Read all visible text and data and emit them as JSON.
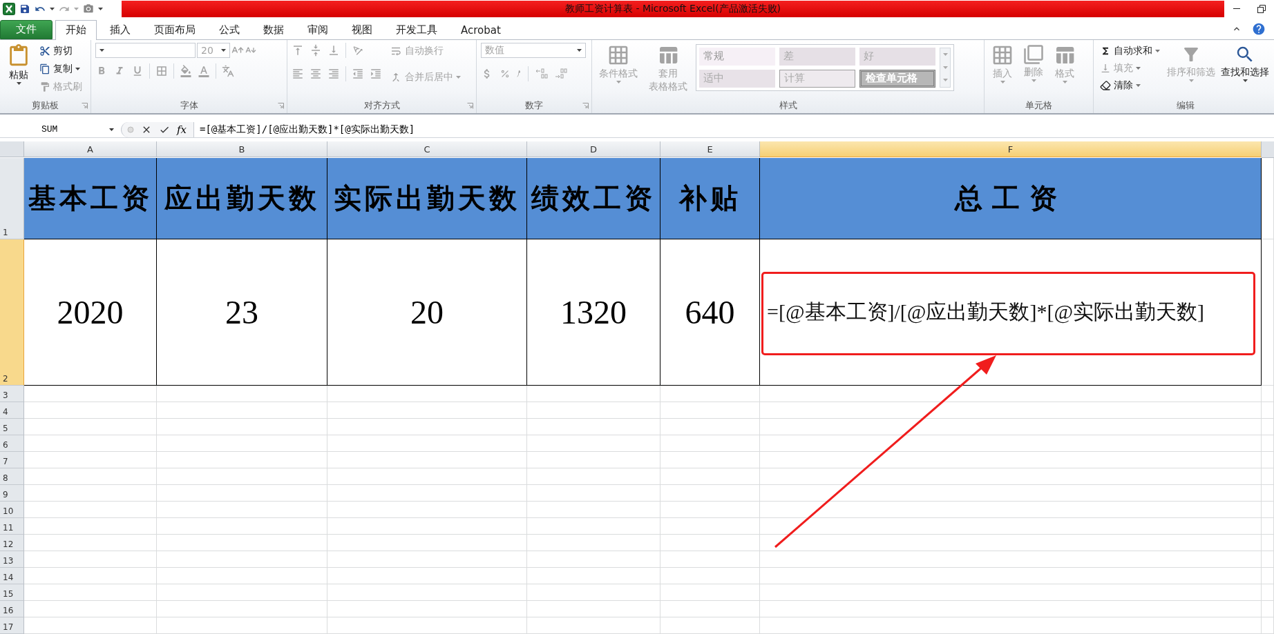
{
  "title_bar": {
    "title": "教师工资计算表 - Microsoft Excel(产品激活失败)"
  },
  "tabs": [
    {
      "label": "文件",
      "kind": "file",
      "selected": false
    },
    {
      "label": "开始",
      "kind": "tab",
      "selected": true
    },
    {
      "label": "插入",
      "kind": "tab",
      "selected": false
    },
    {
      "label": "页面布局",
      "kind": "tab",
      "selected": false
    },
    {
      "label": "公式",
      "kind": "tab",
      "selected": false
    },
    {
      "label": "数据",
      "kind": "tab",
      "selected": false
    },
    {
      "label": "审阅",
      "kind": "tab",
      "selected": false
    },
    {
      "label": "视图",
      "kind": "tab",
      "selected": false
    },
    {
      "label": "开发工具",
      "kind": "tab",
      "selected": false
    },
    {
      "label": "Acrobat",
      "kind": "tab",
      "selected": false
    }
  ],
  "ribbon": {
    "clipboard": {
      "label": "剪贴板",
      "paste": {
        "label": "粘贴",
        "disabled": false
      },
      "cut": {
        "label": "剪切",
        "disabled": false
      },
      "copy": {
        "label": "复制",
        "disabled": false
      },
      "format_painter": {
        "label": "格式刷",
        "disabled": true
      }
    },
    "font": {
      "label": "字体",
      "font_size": "20",
      "icons_disabled": true
    },
    "alignment": {
      "label": "对齐方式",
      "icons_disabled": true,
      "wrap_text": {
        "label": "自动换行",
        "disabled": true
      },
      "merge_center": {
        "label": "合并后居中",
        "disabled": true
      }
    },
    "number": {
      "label": "数字",
      "format": "数值",
      "icons_disabled": true
    },
    "styles": {
      "label": "样式",
      "conditional_format": {
        "label": "条件格式",
        "disabled": true
      },
      "table_format": {
        "label": [
          "套用",
          "表格格式"
        ],
        "disabled": true
      },
      "cell_styles": [
        {
          "label": "常规",
          "kind": "normal"
        },
        {
          "label": "差",
          "kind": "bad"
        },
        {
          "label": "好",
          "kind": "good"
        },
        {
          "label": "适中",
          "kind": "neutral"
        },
        {
          "label": "计算",
          "kind": "calculation"
        },
        {
          "label": "检查单元格",
          "kind": "check"
        }
      ]
    },
    "cells": {
      "label": "单元格",
      "insert": {
        "label": "插入",
        "disabled": true
      },
      "delete": {
        "label": "删除",
        "disabled": true
      },
      "format": {
        "label": "格式",
        "disabled": true
      }
    },
    "editing": {
      "label": "编辑",
      "autosum": {
        "label": "自动求和",
        "disabled": false
      },
      "fill": {
        "label": "填充",
        "disabled": true
      },
      "clear": {
        "label": "清除",
        "disabled": false
      },
      "sort_filter": {
        "label": "排序和筛选",
        "disabled": true
      },
      "find_select": {
        "label": "查找和选择",
        "disabled": false
      }
    }
  },
  "formula_bar": {
    "name_box": "SUM",
    "function_button": "fx",
    "formula": "=[@基本工资]/[@应出勤天数]*[@实际出勤天数]"
  },
  "sheet": {
    "columns": [
      {
        "label": "A",
        "selected": false
      },
      {
        "label": "B",
        "selected": false
      },
      {
        "label": "C",
        "selected": false
      },
      {
        "label": "D",
        "selected": false
      },
      {
        "label": "E",
        "selected": false
      },
      {
        "label": "F",
        "selected": true
      }
    ],
    "rows": [
      {
        "header": "1",
        "selected": false,
        "kind": "header",
        "cells": [
          "基本工资",
          "应出勤天数",
          "实际出勤天数",
          "绩效工资",
          "补贴",
          "总工资"
        ]
      },
      {
        "header": "2",
        "selected": true,
        "kind": "data",
        "cells": [
          "2020",
          "23",
          "20",
          "1320",
          "640",
          "=[@基本工资]/[@应出勤天数]*[@实际出勤天数]"
        ]
      },
      {
        "header": "3",
        "selected": false
      },
      {
        "header": "4",
        "selected": false
      },
      {
        "header": "5",
        "selected": false
      },
      {
        "header": "6",
        "selected": false
      },
      {
        "header": "7",
        "selected": false
      },
      {
        "header": "8",
        "selected": false
      },
      {
        "header": "9",
        "selected": false
      },
      {
        "header": "10",
        "selected": false
      },
      {
        "header": "11",
        "selected": false
      },
      {
        "header": "12",
        "selected": false
      },
      {
        "header": "13",
        "selected": false
      },
      {
        "header": "14",
        "selected": false
      },
      {
        "header": "15",
        "selected": false
      },
      {
        "header": "16",
        "selected": false
      },
      {
        "header": "17",
        "selected": false
      }
    ]
  }
}
